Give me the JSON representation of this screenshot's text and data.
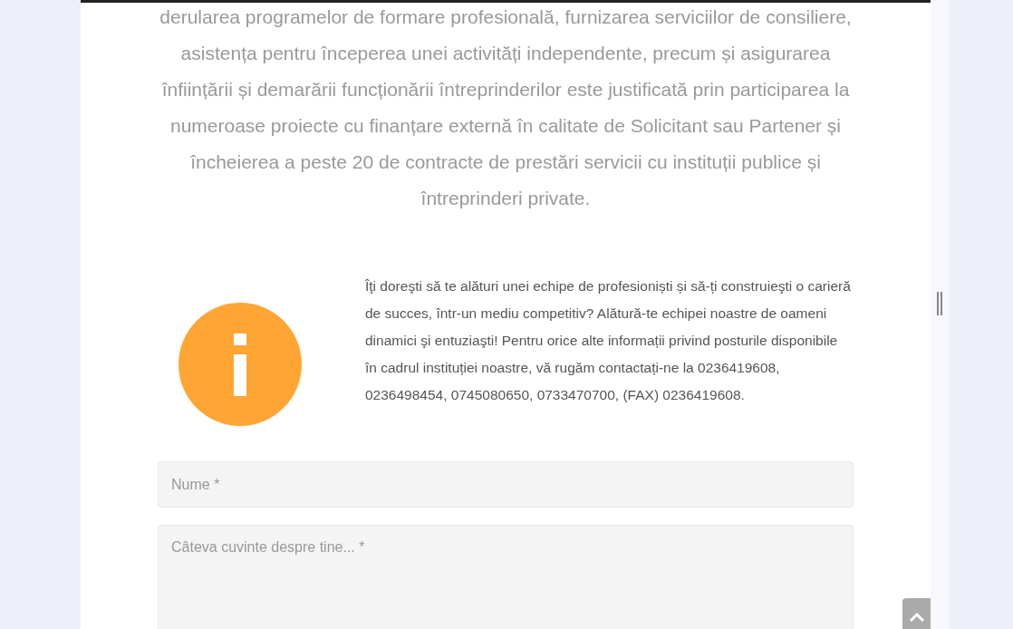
{
  "intro_paragraph": "derularea programelor de formare profesională, furnizarea serviciilor de consiliere, asistența pentru începerea unei activități independente, precum și asigurarea înființării și demarării funcționării întreprinderilor este justificată prin participarea la numeroase proiecte cu finanțare externă în calitate de Solicitant sau Partener și încheierea a peste 20 de contracte de prestări servicii cu instituții publice și întreprinderi private.",
  "careers_text": "Îţi doreşti să te alături unei echipe de profesioniști și să-ți construieşti o carieră de succes, într-un mediu competitiv? Alătură-te echipei noastre de oameni dinamici şi entuziaşti! Pentru orice alte informații privind posturile disponibile în cadrul instituției noastre, vă rugăm contactați-ne la 0236419608, 0236498454, 0745080650, 0733470700, (FAX) 0236419608.",
  "form": {
    "fields": [
      {
        "kind": "input",
        "placeholder": "Nume *"
      },
      {
        "kind": "textarea",
        "placeholder": "Câteva cuvinte despre tine... *"
      }
    ]
  }
}
